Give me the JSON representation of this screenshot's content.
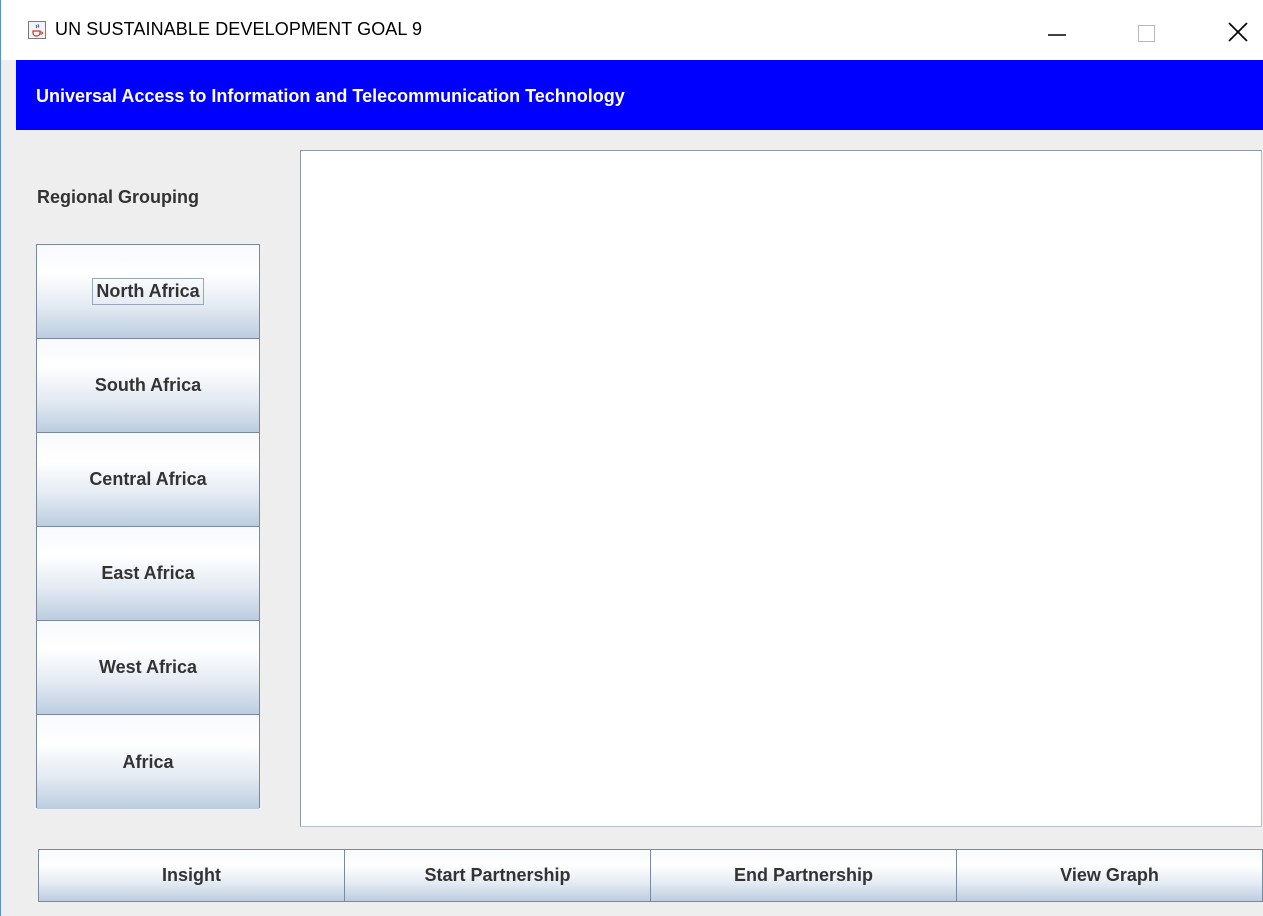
{
  "window": {
    "title": "UN SUSTAINABLE DEVELOPMENT GOAL 9",
    "icon": "java-cup-icon",
    "controls": [
      "minimize-icon",
      "maximize-icon",
      "close-icon"
    ]
  },
  "header": {
    "title": "Universal Access to Information and Telecommunication Technology",
    "background_color": "#0000ff",
    "text_color": "#ffffff"
  },
  "sidebar": {
    "label": "Regional Grouping",
    "items": [
      {
        "label": "North Africa",
        "focused": true
      },
      {
        "label": "South Africa",
        "focused": false
      },
      {
        "label": "Central Africa",
        "focused": false
      },
      {
        "label": "East Africa",
        "focused": false
      },
      {
        "label": "West Africa",
        "focused": false
      },
      {
        "label": "Africa",
        "focused": false
      }
    ]
  },
  "actions": [
    {
      "label": "Insight"
    },
    {
      "label": "Start Partnership"
    },
    {
      "label": "End Partnership"
    },
    {
      "label": "View Graph"
    }
  ]
}
